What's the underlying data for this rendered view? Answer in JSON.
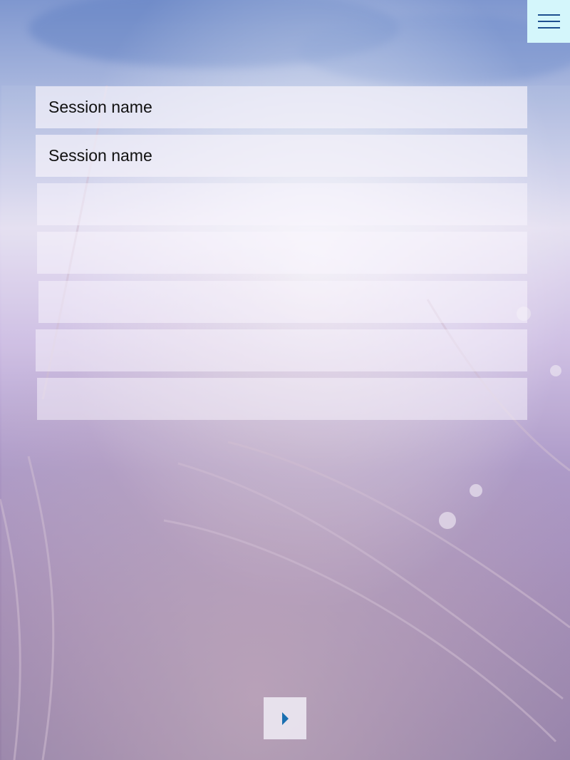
{
  "menu": {
    "icon": "hamburger-menu-icon"
  },
  "sessions": [
    {
      "name": "Session name"
    },
    {
      "name": "Session name"
    },
    {
      "name": ""
    },
    {
      "name": ""
    },
    {
      "name": ""
    },
    {
      "name": ""
    },
    {
      "name": ""
    }
  ],
  "next": {
    "icon": "play-arrow-icon"
  },
  "colors": {
    "menu_bg": "#d4f6fb",
    "menu_icon": "#1d4f8f",
    "arrow": "#1a6fb0"
  }
}
